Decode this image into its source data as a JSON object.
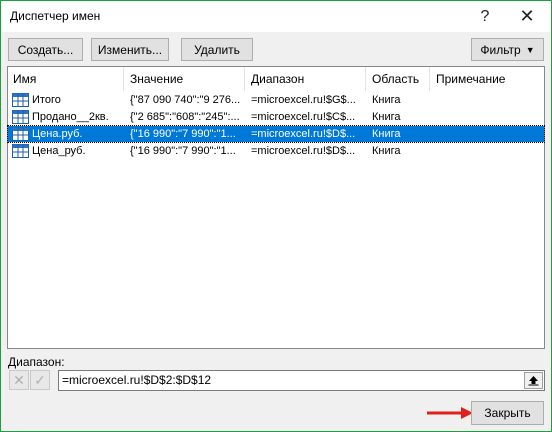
{
  "window": {
    "title": "Диспетчер имен",
    "help_label": "?",
    "close_label": "✕"
  },
  "toolbar": {
    "create_label": "Создать...",
    "edit_label": "Изменить...",
    "delete_label": "Удалить",
    "filter_label": "Фильтр"
  },
  "table": {
    "columns": [
      "Имя",
      "Значение",
      "Диапазон",
      "Область",
      "Примечание"
    ],
    "rows": [
      {
        "name": "Итого",
        "value": "{\"87 090 740\":\"9 276...",
        "range": "=microexcel.ru!$G$...",
        "scope": "Книга",
        "note": "",
        "selected": false
      },
      {
        "name": "Продано__2кв.",
        "value": "{\"2 685\":\"608\":\"245\":...",
        "range": "=microexcel.ru!$C$...",
        "scope": "Книга",
        "note": "",
        "selected": false
      },
      {
        "name": "Цена.руб.",
        "value": "{\"16 990\":\"7 990\":\"1...",
        "range": "=microexcel.ru!$D$...",
        "scope": "Книга",
        "note": "",
        "selected": true
      },
      {
        "name": "Цена_руб.",
        "value": "{\"16 990\":\"7 990\":\"1...",
        "range": "=microexcel.ru!$D$...",
        "scope": "Книга",
        "note": "",
        "selected": false
      }
    ]
  },
  "range_section": {
    "label": "Диапазон:",
    "value": "=microexcel.ru!$D$2:$D$12"
  },
  "footer": {
    "close_label": "Закрыть"
  },
  "colors": {
    "selection": "#0078d7",
    "border": "#1e9e3c",
    "arrow": "#e0201b"
  },
  "icons": [
    "help-icon",
    "close-icon",
    "chevron-down-icon",
    "table-icon",
    "cancel-x-icon",
    "check-icon",
    "collapse-dialog-icon",
    "red-arrow-icon"
  ]
}
